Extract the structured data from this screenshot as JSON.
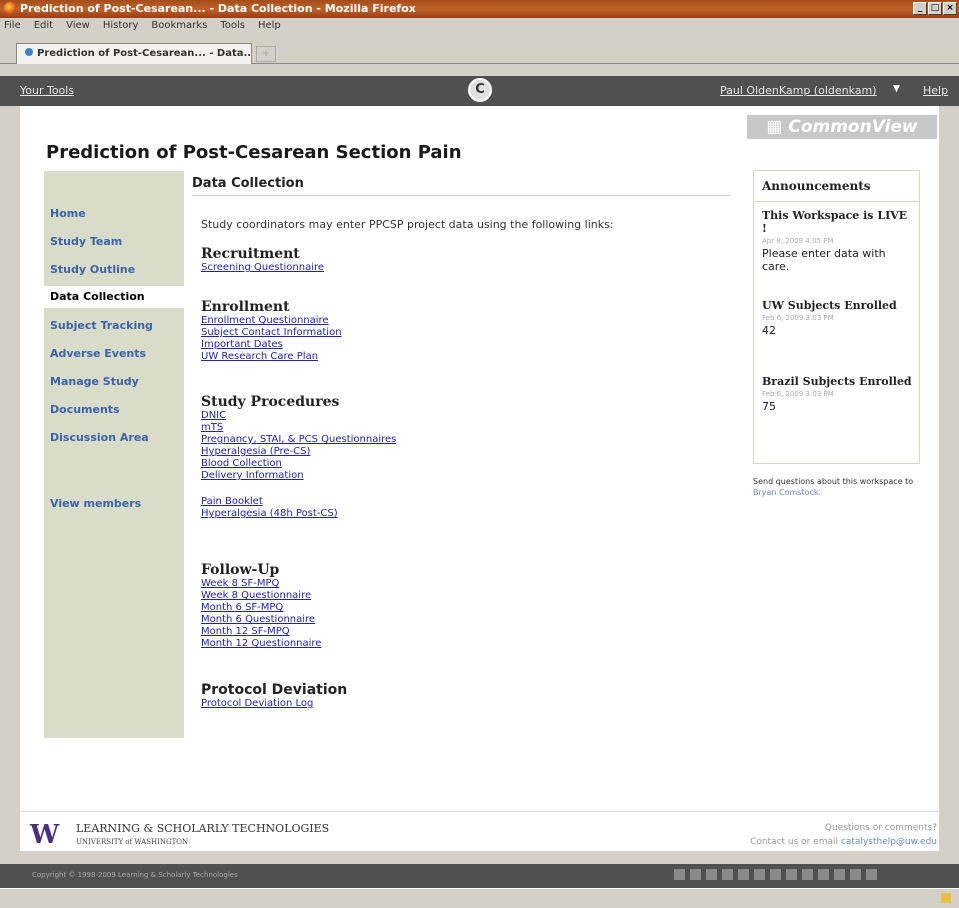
{
  "window": {
    "title": "Prediction of Post-Cesarean... - Data Collection - Mozilla Firefox",
    "controls": [
      "_",
      "□",
      "×"
    ]
  },
  "menu": [
    "File",
    "Edit",
    "View",
    "History",
    "Bookmarks",
    "Tools",
    "Help"
  ],
  "tab": {
    "label": "Prediction of Post-Cesarean... - Data...",
    "new_tab": "+"
  },
  "sitebar": {
    "tools": "Your Tools",
    "logo": "C",
    "user": "Paul OldenKamp (oldenkam)",
    "caret": "▼",
    "help": "Help"
  },
  "brand": "CommonView",
  "page_title": "Prediction of Post-Cesarean Section Pain",
  "nav": {
    "items": [
      {
        "label": "Home"
      },
      {
        "label": "Study Team"
      },
      {
        "label": "Study Outline"
      },
      {
        "label": "Data Collection"
      },
      {
        "label": "Subject Tracking"
      },
      {
        "label": "Adverse Events"
      },
      {
        "label": "Manage Study"
      },
      {
        "label": "Documents"
      },
      {
        "label": "Discussion Area"
      },
      {
        "label": "View members"
      }
    ]
  },
  "main": {
    "section_title": "Data Collection",
    "intro": "Study coordinators may enter PPCSP project data using the following links:",
    "groups": [
      {
        "heading": "Recruitment",
        "links": [
          "Screening Questionnaire"
        ]
      },
      {
        "heading": "Enrollment",
        "links": [
          "Enrollment Questionnaire",
          "Subject Contact Information",
          "Important Dates",
          "UW Research Care Plan"
        ]
      },
      {
        "heading": "Study Procedures",
        "links": [
          "DNIC",
          "mTS",
          "Pregnancy, STAI, & PCS Questionnaires",
          "Hyperalgesia (Pre-CS)",
          "Blood Collection",
          "Delivery Information"
        ],
        "links2": [
          "Pain Booklet",
          "Hyperalgesia (48h Post-CS)"
        ]
      },
      {
        "heading": "Follow-Up",
        "links": [
          "Week 8 SF-MPQ",
          "Week 8 Questionnaire",
          "Month 6 SF-MPQ",
          "Month 6 Questionnaire",
          "Month 12 SF-MPQ",
          "Month 12 Questionnaire"
        ]
      },
      {
        "heading": "Protocol Deviation",
        "links": [
          "Protocol Deviation Log"
        ]
      }
    ]
  },
  "announcements": {
    "title": "Announcements",
    "entries": [
      {
        "title": "This Workspace is LIVE !",
        "date": "Apr 8, 2009 4:05 PM",
        "body": "Please enter data with care."
      },
      {
        "title": "UW Subjects Enrolled",
        "date": "Feb 6, 2009 3:03 PM",
        "body": "42"
      },
      {
        "title": "Brazil Subjects Enrolled",
        "date": "Feb 6, 2009 3:03 PM",
        "body": "75"
      }
    ],
    "send_text": "Send questions about this workspace to",
    "send_link": "Bryan Comstock."
  },
  "footer": {
    "uw_logo": "W",
    "org": "LEARNING & SCHOLARLY TECHNOLOGIES",
    "university": "UNIVERSITY of WASHINGTON",
    "questions": "Questions or comments?",
    "contact_text": "Contact us or email",
    "contact_link": "catalysthelp@uw.edu",
    "copyright": "Copyright © 1998-2009 Learning & Scholarly Technologies"
  }
}
